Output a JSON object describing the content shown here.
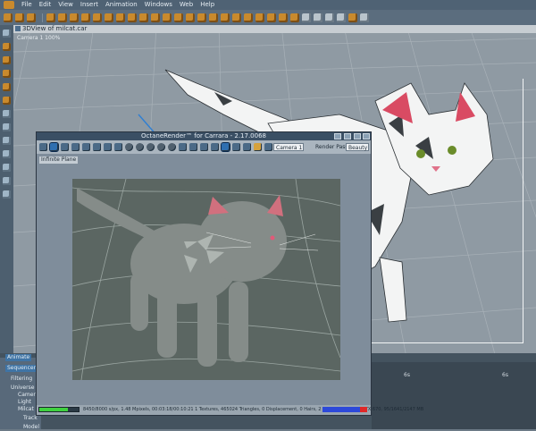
{
  "menu": {
    "items": [
      "File",
      "Edit",
      "View",
      "Insert",
      "Animation",
      "Windows",
      "Web",
      "Help"
    ]
  },
  "toolbar": {
    "icons": [
      "select-tool-icon",
      "move-tool-icon",
      "rotate-tool-icon",
      "scale-tool-icon",
      "camera-icon",
      "light-icon",
      "sphere-icon",
      "cube-icon",
      "render-icon"
    ]
  },
  "view3d": {
    "title": "3DView of milcat.car",
    "camera_label": "Camera 1 100%"
  },
  "octane": {
    "title": "OctaneRender™ for Carrara - 2.17.0068",
    "camera_select": "Camera 1",
    "render_pass_label": "Render Pass",
    "render_pass_select": "Beauty",
    "node_label": "Infinite Plane",
    "progress_fraction": 0.73,
    "status_text": "8450/8000 s/px, 1.48 Mpixels, 00:03:18/00:10:21    1 Textures, 465024 Triangles, 0 Displacement, 0 Hairs, 2 Meshes, GeForce GTX 670, 95/1641/2147 MB"
  },
  "bottom": {
    "tabs": [
      "Animate",
      "Sequencer"
    ],
    "tree": [
      "Filtering",
      "Universe",
      "Camera",
      "Light",
      "Milcat",
      "Track",
      "Model"
    ],
    "timeline_ticks": [
      "6s",
      "6s"
    ]
  },
  "colors": {
    "accent": "#c98a2d",
    "octane_titlebar": "#3a4f64",
    "progress": "#3fd13f"
  }
}
